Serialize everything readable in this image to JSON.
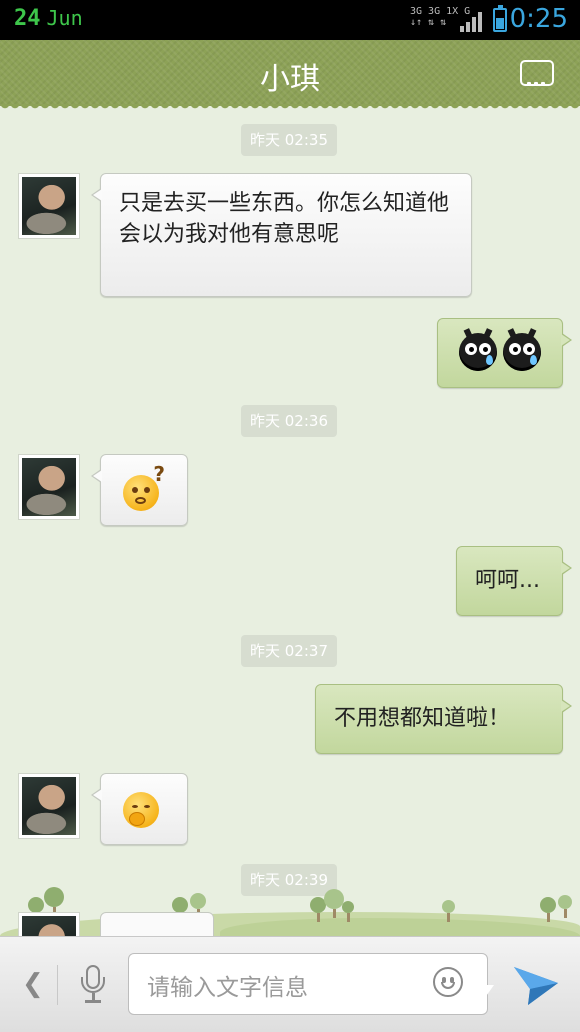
{
  "status_bar": {
    "date_day": "24",
    "date_month": "Jun",
    "network_line1": "3G 3G 1X G",
    "time": "0:25"
  },
  "header": {
    "title": "小琪",
    "menu_icon": "more-dots-icon"
  },
  "messages": [
    {
      "type": "timestamp",
      "text": "昨天 02:35"
    },
    {
      "type": "incoming",
      "kind": "text",
      "text": "只是去买一些东西。你怎么知道他会以为我对他有意思呢"
    },
    {
      "type": "outgoing",
      "kind": "emoticon",
      "emoticons": [
        "crying-black-face",
        "crying-black-face"
      ]
    },
    {
      "type": "timestamp",
      "text": "昨天 02:36"
    },
    {
      "type": "incoming",
      "kind": "emoticon",
      "emoticons": [
        "confused-question-face"
      ]
    },
    {
      "type": "outgoing",
      "kind": "text",
      "text": "呵呵..."
    },
    {
      "type": "timestamp",
      "text": "昨天 02:37"
    },
    {
      "type": "outgoing",
      "kind": "text",
      "text": "不用想都知道啦！"
    },
    {
      "type": "incoming",
      "kind": "emoticon",
      "emoticons": [
        "giggling-face"
      ]
    },
    {
      "type": "timestamp",
      "text": "昨天 02:39"
    }
  ],
  "input_bar": {
    "placeholder": "请输入文字信息",
    "icons": [
      "back-chevron-icon",
      "microphone-icon",
      "emoji-icon",
      "send-icon"
    ]
  },
  "colors": {
    "header_green": "#8da257",
    "chat_background": "#e8efe0",
    "outgoing_bubble": "#c9dca6",
    "time_accent": "#3aa6de",
    "date_accent": "#3ec64b"
  }
}
